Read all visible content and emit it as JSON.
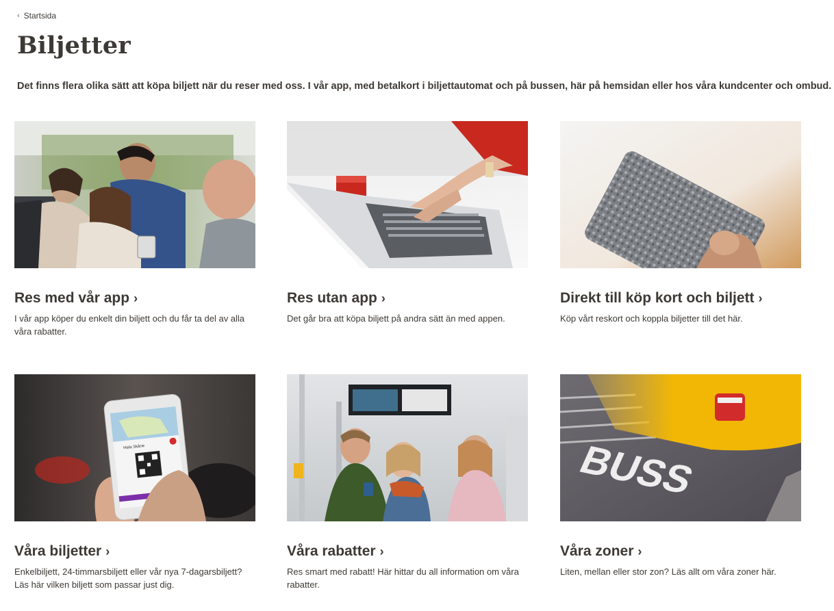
{
  "breadcrumb": {
    "chevron": "‹",
    "label": "Startsida"
  },
  "page": {
    "title": "Biljetter",
    "intro": "Det finns flera olika sätt att köpa biljett när du reser med oss. I vår app, med betalkort i biljettautomat och på bussen, här på hemsidan eller hos våra kundcenter och ombud."
  },
  "cards": [
    {
      "title": "Res med vår app",
      "arrow": "›",
      "description": "I vår app köper du enkelt din biljett och du får ta del av alla våra rabatter."
    },
    {
      "title": "Res utan app",
      "arrow": "›",
      "description": "Det går bra att köpa biljett på andra sätt än med appen."
    },
    {
      "title": "Direkt till köp kort och biljett",
      "arrow": "›",
      "description": "Köp vårt reskort och koppla biljetter till det här."
    },
    {
      "title": "Våra biljetter",
      "arrow": "›",
      "description": "Enkelbiljett, 24-timmarsbiljett eller vår nya 7-dagarsbiljett? Läs här vilken biljett som passar just dig."
    },
    {
      "title": "Våra rabatter",
      "arrow": "›",
      "description": "Res smart med rabatt! Här hittar du all information om våra rabatter."
    },
    {
      "title": "Våra zoner",
      "arrow": "›",
      "description": "Liten, mellan eller stor zon? Läs allt om våra zoner här."
    }
  ],
  "images": {
    "road_marking": "BUSS",
    "phone_app_label": "Hela Skåne"
  },
  "colors": {
    "text": "#3d3935",
    "bus_yellow": "#f2b705",
    "shirt_red": "#c8281e"
  }
}
